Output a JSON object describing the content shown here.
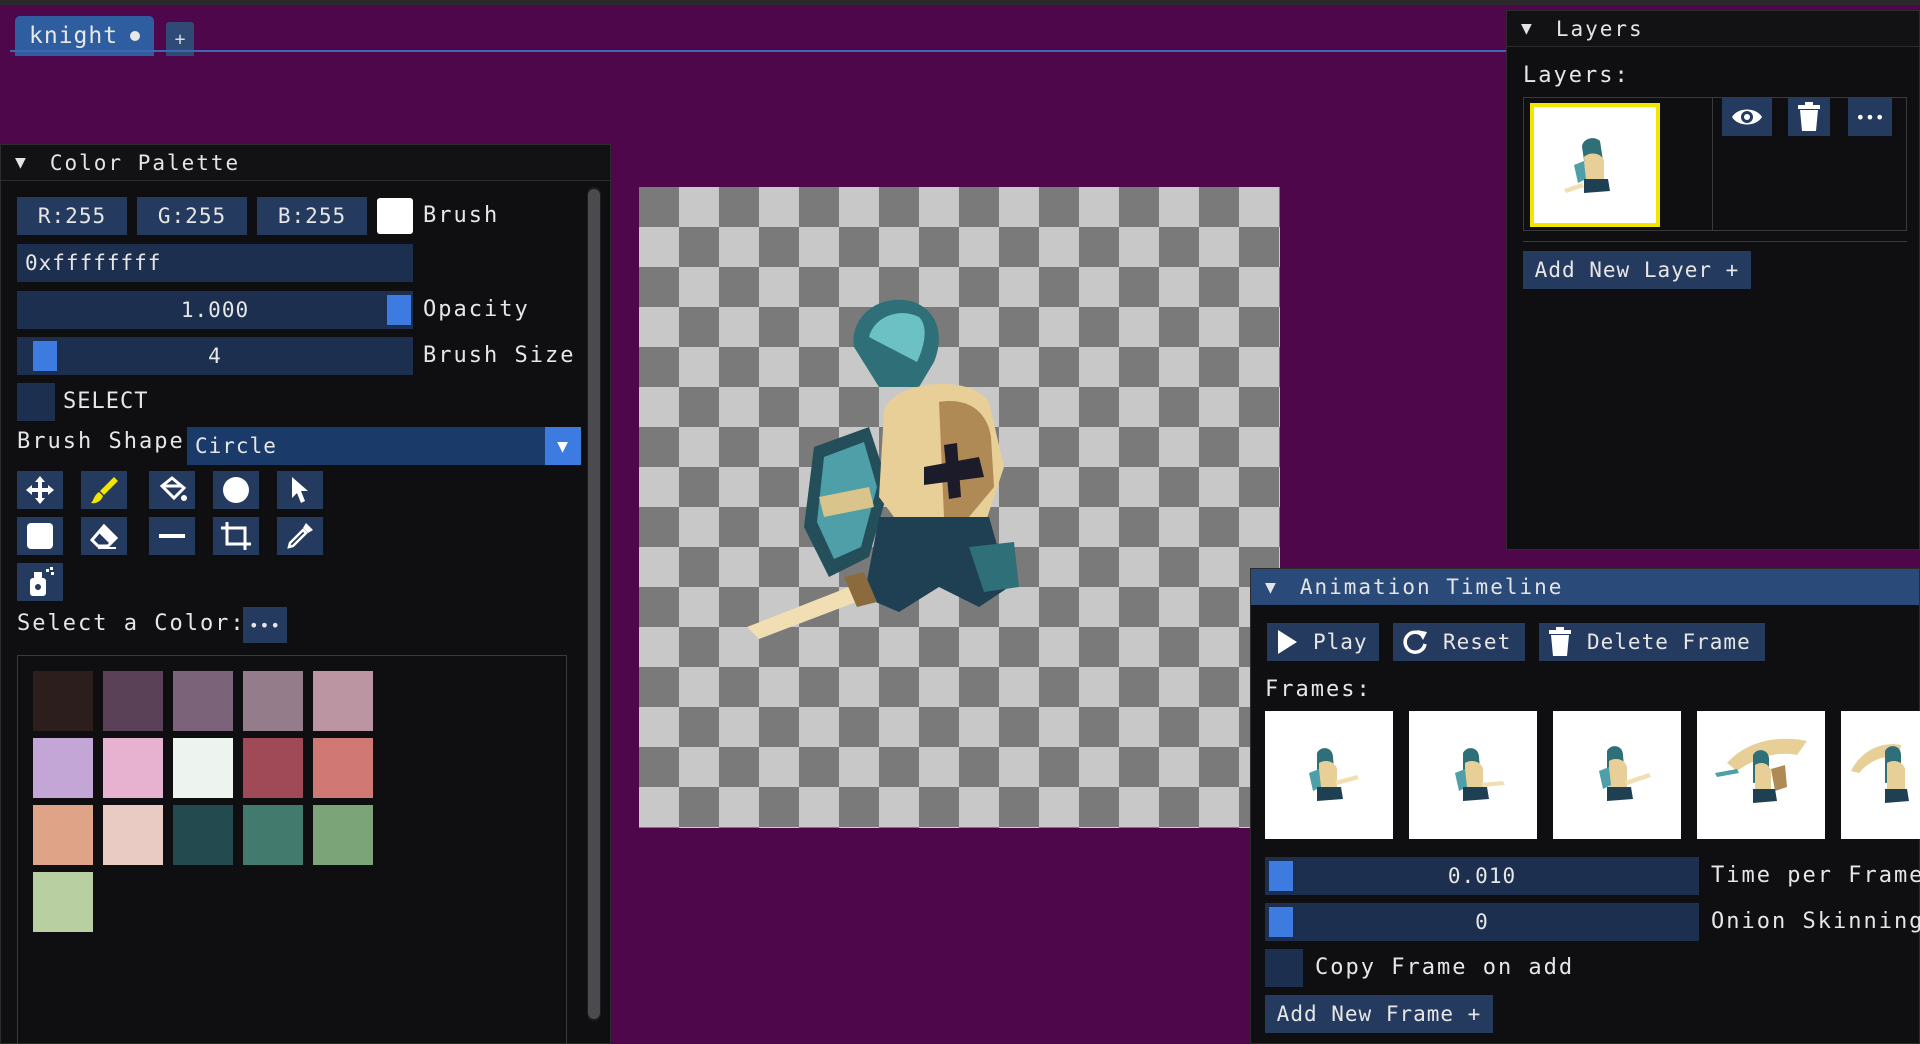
{
  "tabs": [
    {
      "label": "knight"
    }
  ],
  "tab_add_label": "+",
  "color_palette": {
    "title": "Color Palette",
    "r_label": "R:255",
    "g_label": "G:255",
    "b_label": "B:255",
    "brush_label": "Brush",
    "brush_color": "#ffffff",
    "hex_value": "0xffffffff",
    "opacity_value": "1.000",
    "opacity_label": "Opacity",
    "opacity_level": 1.0,
    "brush_size_value": "4",
    "brush_size_label": "Brush Size",
    "select_label": "SELECT",
    "brush_shape_label": "Brush Shape",
    "brush_shape_value": "Circle",
    "select_color_label": "Select a Color:",
    "more_label": "•••",
    "swatches": [
      "#2d1e1e",
      "#5a4158",
      "#7b6479",
      "#957c8b",
      "#bb96a2",
      "#c3a5d6",
      "#e7b2cf",
      "#edf3ee",
      "#a04a58",
      "#cf7874",
      "#dfa488",
      "#eacbc3",
      "#224a4f",
      "#427a6e",
      "#7ba478",
      "#b8cfa1"
    ]
  },
  "layers": {
    "title": "Layers",
    "label": "Layers:",
    "more_label": "•••",
    "add_label": "Add New Layer +"
  },
  "timeline": {
    "title": "Animation Timeline",
    "play_label": "Play",
    "reset_label": "Reset",
    "delete_label": "Delete Frame",
    "frames_label": "Frames:",
    "time_value": "0.010",
    "time_label": "Time per Frame",
    "onion_value": "0",
    "onion_label": "Onion Skinning",
    "copy_label": "Copy Frame on add",
    "add_frame_label": "Add New Frame +"
  },
  "colors": {
    "background": "#4f074c",
    "accent": "#3d7be0",
    "button": "#243a5e",
    "highlight": "#f2e600"
  }
}
